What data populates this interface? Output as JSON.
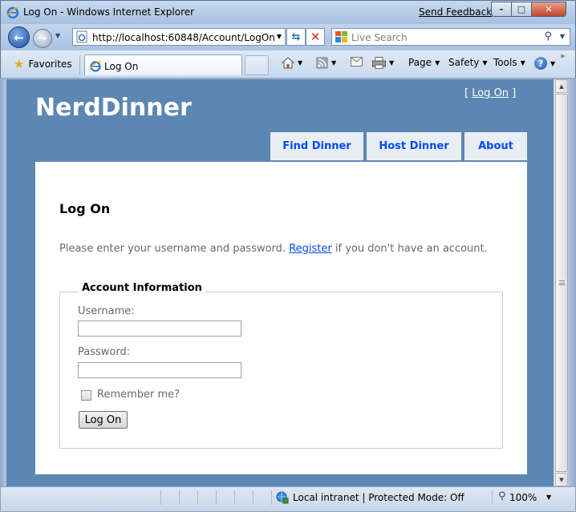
{
  "window": {
    "title": "Log On - Windows Internet Explorer",
    "send_feedback": "Send Feedback",
    "min": "–",
    "max": "□",
    "close": "✕"
  },
  "nav": {
    "url": "http://localhost:60848/Account/LogOn",
    "search_placeholder": "Live Search"
  },
  "tabbar": {
    "favorites": "Favorites",
    "tab_label": "Log On",
    "page": "Page",
    "safety": "Safety",
    "tools": "Tools",
    "help": "?"
  },
  "site": {
    "title": "NerdDinner",
    "login_open": "[ ",
    "login_link": "Log On",
    "login_close": " ]",
    "menu": [
      "Find Dinner",
      "Host Dinner",
      "About"
    ]
  },
  "logon": {
    "heading": "Log On",
    "intro_before": "Please enter your username and password. ",
    "register_link": "Register",
    "intro_after": " if you don't have an account.",
    "legend": "Account Information",
    "username_label": "Username:",
    "password_label": "Password:",
    "username_value": "",
    "password_value": "",
    "remember_label": "Remember me?",
    "remember_checked": false,
    "submit": "Log On"
  },
  "status": {
    "zone": "Local intranet | Protected Mode: Off",
    "zoom": "100%"
  },
  "colors": {
    "page_background": "#5c87b2",
    "link": "#034af3",
    "menu_tab": "#e8eef4",
    "body_text": "#696969"
  }
}
